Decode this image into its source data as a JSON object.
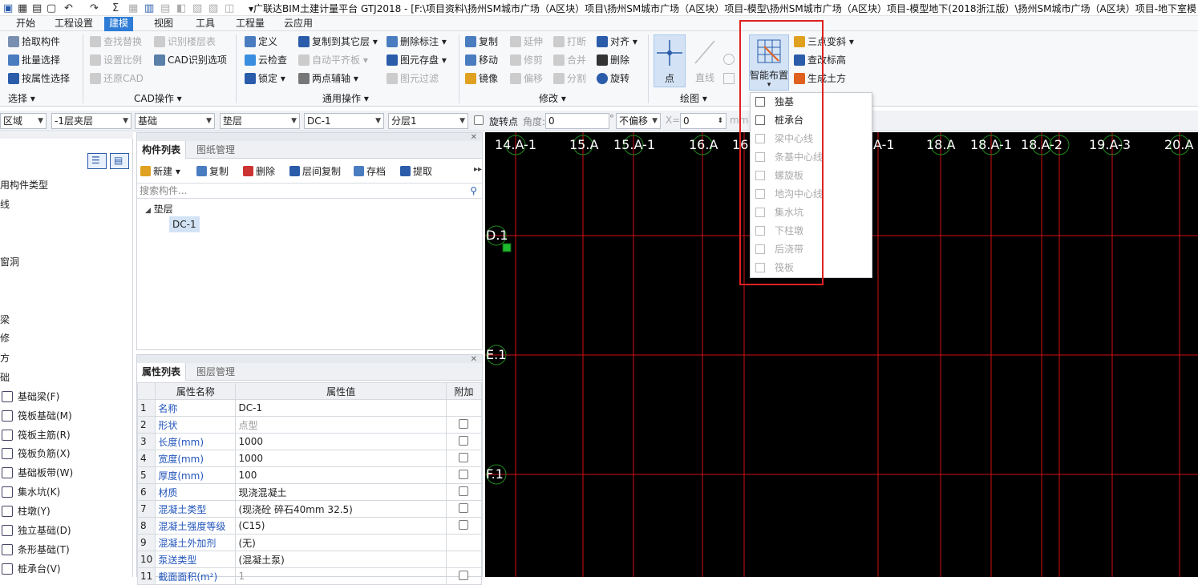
{
  "title_bar": {
    "title": "▾广联达BIM土建计量平台 GTJ2018 - [F:\\项目资料\\扬州SM城市广场（A区块）项目\\扬州SM城市广场（A区块）项目-模型\\扬州SM城市广场（A区块）项目-模型地下(2018浙江版）\\扬州SM城市广场（A区块）项目-地下室模"
  },
  "menu": [
    "开始",
    "工程设置",
    "建模",
    "视图",
    "工具",
    "工程量",
    "云应用"
  ],
  "ribbon": {
    "select": {
      "items": [
        "拾取构件",
        "批量选择",
        "按属性选择"
      ],
      "label": "选择"
    },
    "cad": {
      "items": [
        "查找替换",
        "识别楼层表",
        "设置比例",
        "CAD识别选项",
        "还原CAD"
      ],
      "label": "CAD操作"
    },
    "common": {
      "items": [
        "定义",
        "复制到其它层",
        "云检查",
        "自动平齐板",
        "锁定",
        "两点辅轴"
      ],
      "label": "通用操作"
    },
    "common_extra": {
      "items": [
        "删除标注",
        "图元存盘",
        "图元过滤"
      ]
    },
    "modify": {
      "items": [
        "复制",
        "延伸",
        "打断",
        "对齐",
        "移动",
        "修剪",
        "合并",
        "删除",
        "镜像",
        "偏移",
        "分割",
        "旋转"
      ],
      "label": "修改"
    },
    "draw": {
      "point": "点",
      "line": "直线",
      "label": "绘图"
    },
    "smart": {
      "label": "智能布置",
      "items": [
        "三点变斜",
        "查改标高",
        "生成土方"
      ]
    }
  },
  "propbar": {
    "combos": [
      "区域",
      "-1层夹层",
      "基础",
      "垫层",
      "DC-1",
      "分层1"
    ],
    "rotate_label": "旋转点",
    "angle_label": "角度:",
    "angle_value": "0",
    "degree": "°",
    "offset": "不偏移",
    "x_label": "X=",
    "x_value": "0",
    "unit": "mm"
  },
  "left_tree": {
    "items": [
      "用构件类型",
      "线",
      "",
      "",
      "窗洞",
      "",
      "",
      "梁",
      "修",
      "方",
      "础"
    ],
    "foundation_items": [
      "基础梁(F)",
      "筏板基础(M)",
      "筏板主筋(R)",
      "筏板负筋(X)",
      "基础板带(W)",
      "集水坑(K)",
      "柱墩(Y)",
      "独立基础(D)",
      "条形基础(T)",
      "桩承台(V)"
    ]
  },
  "component_panel": {
    "tabs": [
      "构件列表",
      "图纸管理"
    ],
    "toolbar": [
      "新建",
      "复制",
      "删除",
      "层间复制",
      "存档",
      "提取"
    ],
    "search_placeholder": "搜索构件...",
    "tree_root": "垫层",
    "tree_child": "DC-1"
  },
  "property_panel": {
    "tabs": [
      "属性列表",
      "图层管理"
    ],
    "headers": [
      "属性名称",
      "属性值",
      "附加"
    ],
    "rows": [
      {
        "num": "1",
        "name": "名称",
        "value": "DC-1",
        "check": false
      },
      {
        "num": "2",
        "name": "形状",
        "value": "点型",
        "check": true
      },
      {
        "num": "3",
        "name": "长度(mm)",
        "value": "1000",
        "check": true
      },
      {
        "num": "4",
        "name": "宽度(mm)",
        "value": "1000",
        "check": true
      },
      {
        "num": "5",
        "name": "厚度(mm)",
        "value": "100",
        "check": true
      },
      {
        "num": "6",
        "name": "材质",
        "value": "现浇混凝土",
        "check": true
      },
      {
        "num": "7",
        "name": "混凝土类型",
        "value": "(现浇砼 碎石40mm 32.5)",
        "check": true
      },
      {
        "num": "8",
        "name": "混凝土强度等级",
        "value": "(C15)",
        "check": true
      },
      {
        "num": "9",
        "name": "混凝土外加剂",
        "value": "(无)",
        "check": false
      },
      {
        "num": "10",
        "name": "泵送类型",
        "value": "(混凝土泵)",
        "check": false
      },
      {
        "num": "11",
        "name": "截面面积(m²)",
        "value": "1",
        "check": true
      }
    ]
  },
  "canvas": {
    "top_axes": [
      "14.A-1",
      "15.A",
      "15.A-1",
      "16.A",
      "16",
      "A-1",
      "18.A",
      "18.A-1",
      "18.A-2",
      "19.A",
      "19.A-3",
      "20.A"
    ],
    "side_axes": [
      "D.1",
      "E.1",
      "F.1"
    ]
  },
  "dropdown": {
    "items": [
      {
        "label": "独基",
        "enabled": true
      },
      {
        "label": "桩承台",
        "enabled": true
      },
      {
        "label": "梁中心线",
        "enabled": false
      },
      {
        "label": "条基中心线",
        "enabled": false
      },
      {
        "label": "螺旋板",
        "enabled": false
      },
      {
        "label": "地沟中心线",
        "enabled": false
      },
      {
        "label": "集水坑",
        "enabled": false
      },
      {
        "label": "下柱墩",
        "enabled": false
      },
      {
        "label": "后浇带",
        "enabled": false
      },
      {
        "label": "筏板",
        "enabled": false
      }
    ]
  }
}
